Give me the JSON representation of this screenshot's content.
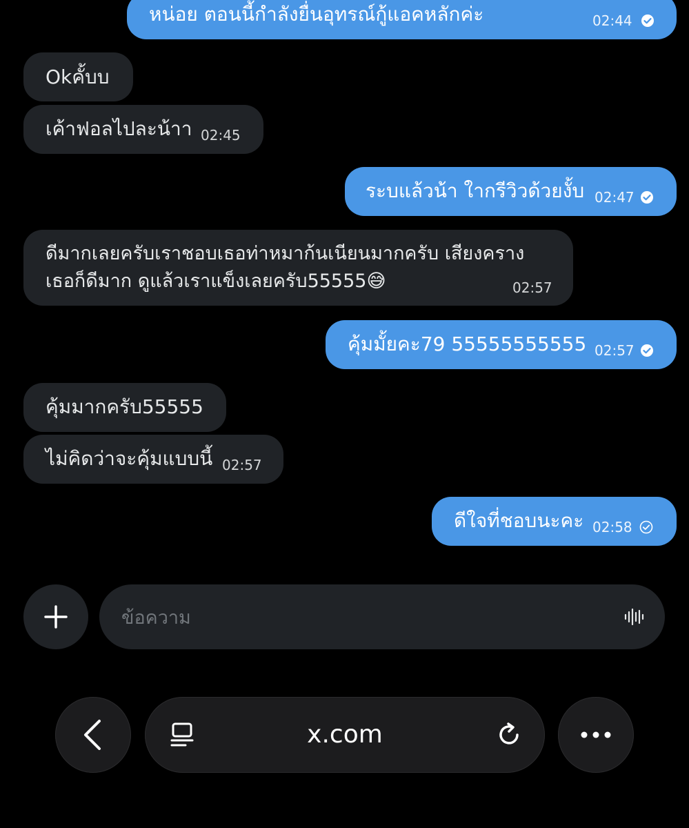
{
  "messages": [
    {
      "id": "m1",
      "text": "หน่อย ตอนนี้กำลังยื่นอุทรณ์กู้แอคหลักค่ะ",
      "time": "02:44"
    },
    {
      "id": "m2",
      "text": "Okคั้บบ"
    },
    {
      "id": "m3",
      "text": "เค้าฟอลไปละน้าา",
      "time": "02:45"
    },
    {
      "id": "m4",
      "text": "ระบแล้วน้า ใากรีวิวด้วยงั้บ",
      "time": "02:47"
    },
    {
      "id": "m5",
      "line1": "ดีมากเลยครับเราชอบเธอท่าหมาก้นเนียนมากครับ เสียงคราง",
      "line2": "เธอก็ดีมาก ดูแล้วเราแข็งเลยครับ55555😅",
      "time": "02:57"
    },
    {
      "id": "m6",
      "text": "คุ้มมั้ยคะ79 55555555555",
      "time": "02:57"
    },
    {
      "id": "m7",
      "text": "คุ้มมากครับ55555"
    },
    {
      "id": "m8",
      "text": "ไม่คิดว่าจะคุ้มแบบนี้",
      "time": "02:57"
    },
    {
      "id": "m9",
      "text": "ดีใจที่ชอบนะคะ",
      "time": "02:58"
    }
  ],
  "composer": {
    "placeholder": "ข้อความ"
  },
  "browser": {
    "url": "x.com"
  },
  "colors": {
    "outgoing": "#4a97e6",
    "incoming": "#202327",
    "background": "#000000"
  }
}
